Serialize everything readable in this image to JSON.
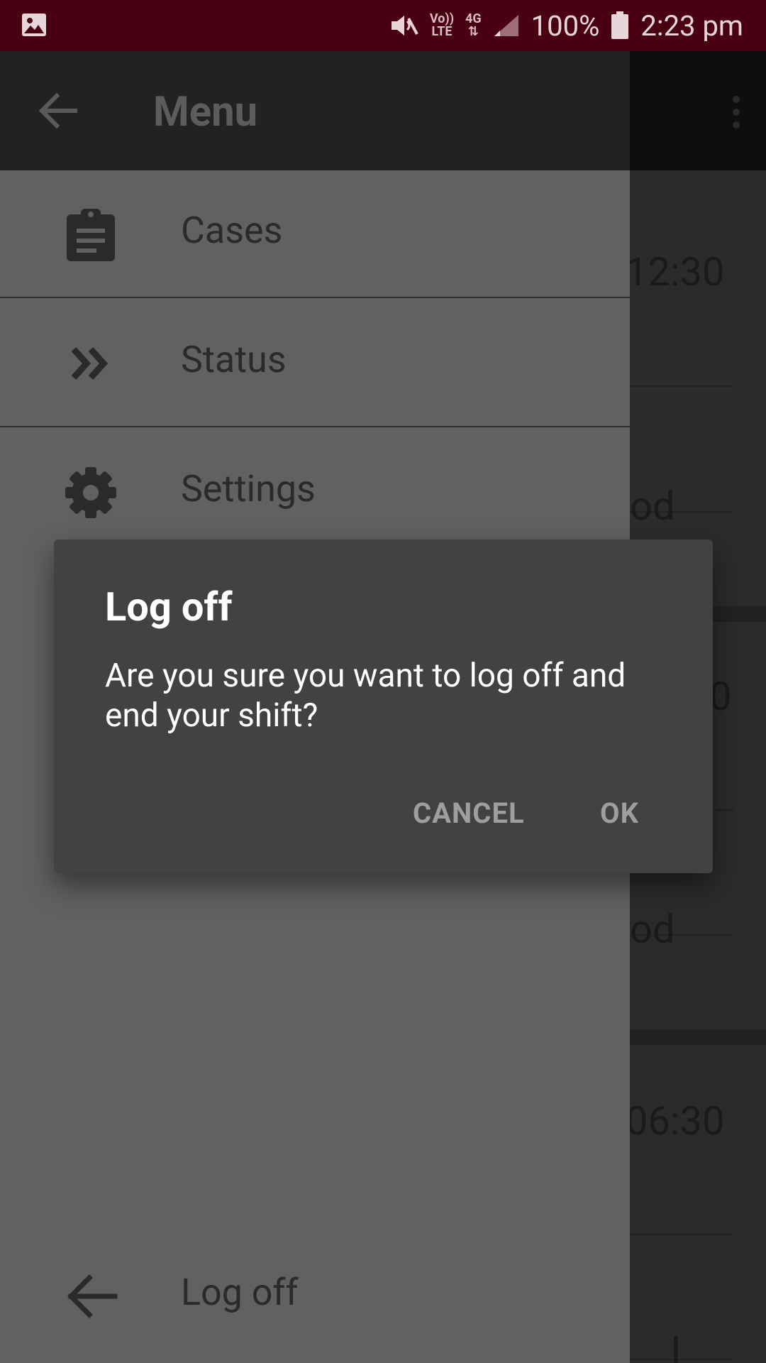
{
  "status_bar": {
    "left_icon": "image-icon",
    "volte": [
      "Vo))",
      "LTE"
    ],
    "network": [
      "4G",
      "⇅"
    ],
    "battery_percent": "100%",
    "time": "2:23 pm"
  },
  "background": {
    "rows": [
      "12:30",
      "od",
      "0",
      "od",
      "06:30",
      "l"
    ]
  },
  "drawer": {
    "title": "Menu",
    "items": [
      {
        "label": "Cases",
        "icon": "clipboard-icon"
      },
      {
        "label": "Status",
        "icon": "double-chevron-icon"
      },
      {
        "label": "Settings",
        "icon": "gear-icon"
      },
      {
        "label": "Log off",
        "icon": "arrow-left-icon"
      }
    ]
  },
  "dialog": {
    "title": "Log off",
    "message": "Are you sure you want to log off and end your shift?",
    "cancel_label": "CANCEL",
    "ok_label": "OK"
  },
  "colors": {
    "status_bar": "#4a0013",
    "drawer": "#616161",
    "dialog": "#424242"
  }
}
